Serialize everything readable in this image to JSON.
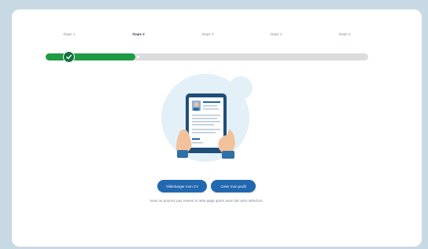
{
  "steps": [
    {
      "label": "étape 1",
      "status": "completed"
    },
    {
      "label": "étape 2",
      "status": "current"
    },
    {
      "label": "étape 3",
      "status": "upcoming"
    },
    {
      "label": "étape 4",
      "status": "upcoming"
    },
    {
      "label": "étape 5",
      "status": "upcoming"
    }
  ],
  "progress": {
    "completed_steps": 1,
    "current_step": 2,
    "total_steps": 5
  },
  "illustration": {
    "icon": "tablet-cv-icon"
  },
  "actions": {
    "upload_cv": "Télécharger mon CV",
    "create_profile": "Créer mon profil"
  },
  "note": "Vous ne pourrez pas revenir à cette page après avoir fait votre sélection.",
  "colors": {
    "progress_fill": "#1f9b45",
    "button": "#2168b0",
    "background": "#c9d9e3"
  }
}
